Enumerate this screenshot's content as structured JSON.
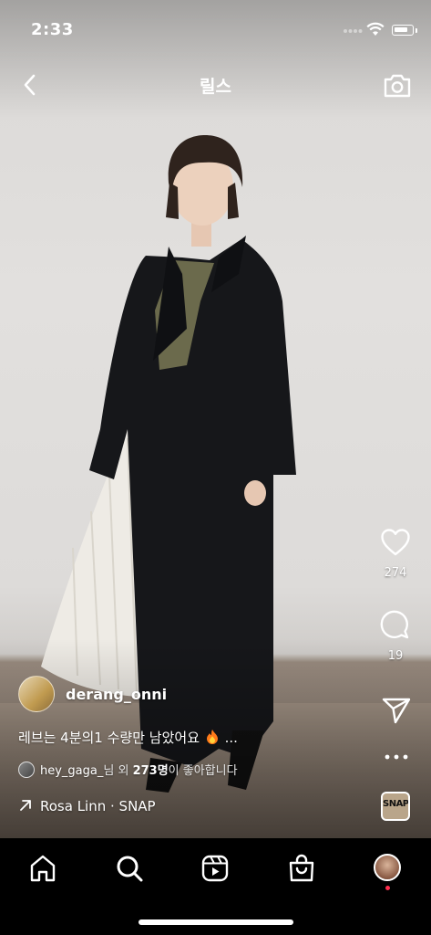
{
  "status_bar": {
    "time": "2:33"
  },
  "header": {
    "title": "릴스"
  },
  "actions": {
    "likes": "274",
    "comments": "19"
  },
  "post": {
    "username": "derang_onni",
    "caption": "레브는 4분의1 수량만 남았어요",
    "caption_more": "...",
    "liked_by_user": "hey_gaga_",
    "liked_by_middle": "님 외 ",
    "liked_by_count": "273명",
    "liked_by_suffix": "이 좋아합니다",
    "audio": "Rosa Linn · SNAP",
    "audio_thumb_text": "SNAP"
  },
  "colors": {
    "notification_dot": "#ff2f4e",
    "background": "#000000"
  },
  "icons": {
    "back": "chevron-left-icon",
    "camera": "camera-icon",
    "like": "heart-icon",
    "comment": "comment-bubble-icon",
    "share": "paper-plane-icon",
    "more": "more-dots-icon",
    "nav": [
      "home-icon",
      "search-icon",
      "reels-icon",
      "shop-icon",
      "profile-avatar"
    ]
  }
}
